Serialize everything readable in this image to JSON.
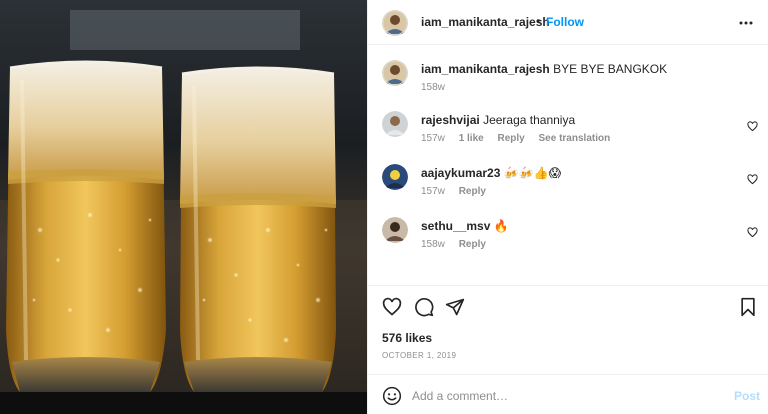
{
  "header": {
    "username": "iam_manikanta_rajesh",
    "separator": "•",
    "follow_label": "Follow"
  },
  "caption": {
    "username": "iam_manikanta_rajesh",
    "text": "BYE BYE BANGKOK",
    "time": "158w"
  },
  "comments": [
    {
      "username": "rajeshvijai",
      "text": "Jeeraga thanniya",
      "time": "157w",
      "likes": "1 like",
      "reply": "Reply",
      "translation": "See translation"
    },
    {
      "username": "aajaykumar23",
      "text": "🍻🍻👍😱",
      "time": "157w",
      "reply": "Reply"
    },
    {
      "username": "sethu__msv",
      "text": "🔥",
      "time": "158w",
      "reply": "Reply"
    }
  ],
  "post": {
    "likes": "576 likes",
    "date": "October 1, 2019"
  },
  "add_comment": {
    "placeholder": "Add a comment…",
    "post_label": "Post"
  },
  "icons": {
    "photo": "beer-glasses-photo",
    "more": "more-options-icon",
    "like": "heart-icon",
    "comment": "comment-icon",
    "share": "share-icon",
    "save": "bookmark-icon",
    "emoji": "emoji-icon"
  },
  "colors": {
    "accent": "#0095f6",
    "muted": "#8e8e8e",
    "text": "#262626",
    "post_disabled": "#b2dffc"
  }
}
